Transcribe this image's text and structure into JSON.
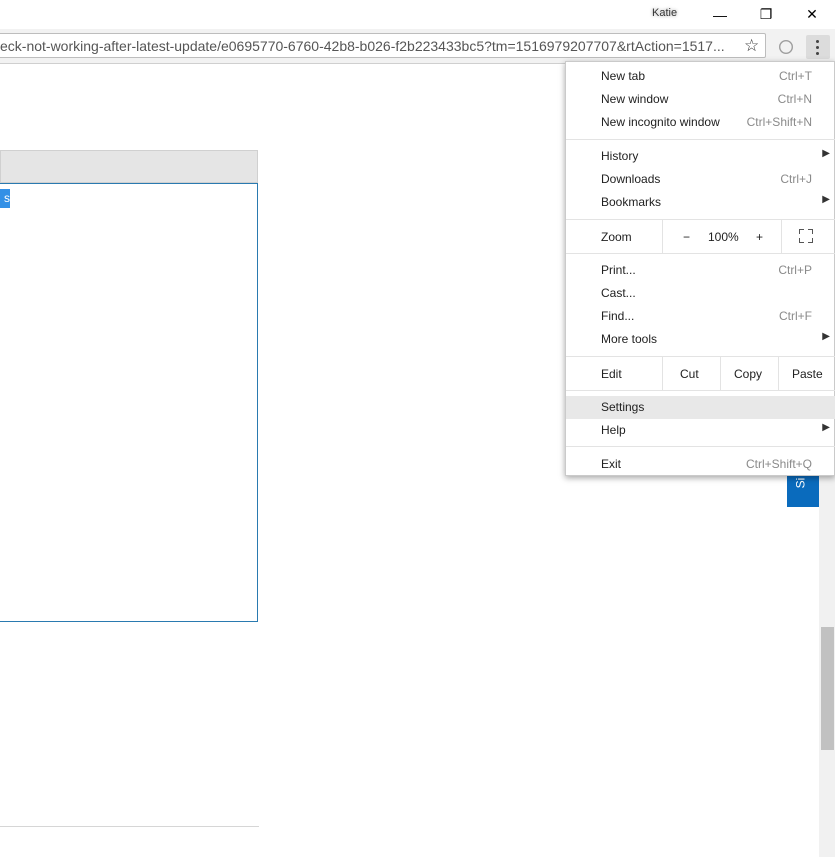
{
  "window": {
    "profile_name": "Katie",
    "minimize": "—",
    "restore": "❐",
    "close": "✕"
  },
  "address_bar": {
    "url": "eck-not-working-after-latest-update/e0695770-6760-42b8-b026-f2b223433bc5?tm=1516979207707&rtAction=1517..."
  },
  "page": {
    "selected_text": "s",
    "side_tab_label": "Si"
  },
  "menu": {
    "new_tab": {
      "label": "New tab",
      "shortcut": "Ctrl+T"
    },
    "new_window": {
      "label": "New window",
      "shortcut": "Ctrl+N"
    },
    "new_incognito": {
      "label": "New incognito window",
      "shortcut": "Ctrl+Shift+N"
    },
    "history": {
      "label": "History"
    },
    "downloads": {
      "label": "Downloads",
      "shortcut": "Ctrl+J"
    },
    "bookmarks": {
      "label": "Bookmarks"
    },
    "zoom": {
      "label": "Zoom",
      "minus": "−",
      "level": "100%",
      "plus": "+"
    },
    "print": {
      "label": "Print...",
      "shortcut": "Ctrl+P"
    },
    "cast": {
      "label": "Cast..."
    },
    "find": {
      "label": "Find...",
      "shortcut": "Ctrl+F"
    },
    "more_tools": {
      "label": "More tools"
    },
    "edit": {
      "label": "Edit",
      "cut": "Cut",
      "copy": "Copy",
      "paste": "Paste"
    },
    "settings": {
      "label": "Settings"
    },
    "help": {
      "label": "Help"
    },
    "exit": {
      "label": "Exit",
      "shortcut": "Ctrl+Shift+Q"
    }
  },
  "colors": {
    "selection": "#3390e6",
    "side_tab": "#0a6bbd",
    "panel_border": "#2a7ab0",
    "menu_hover": "#e8e8e8"
  }
}
